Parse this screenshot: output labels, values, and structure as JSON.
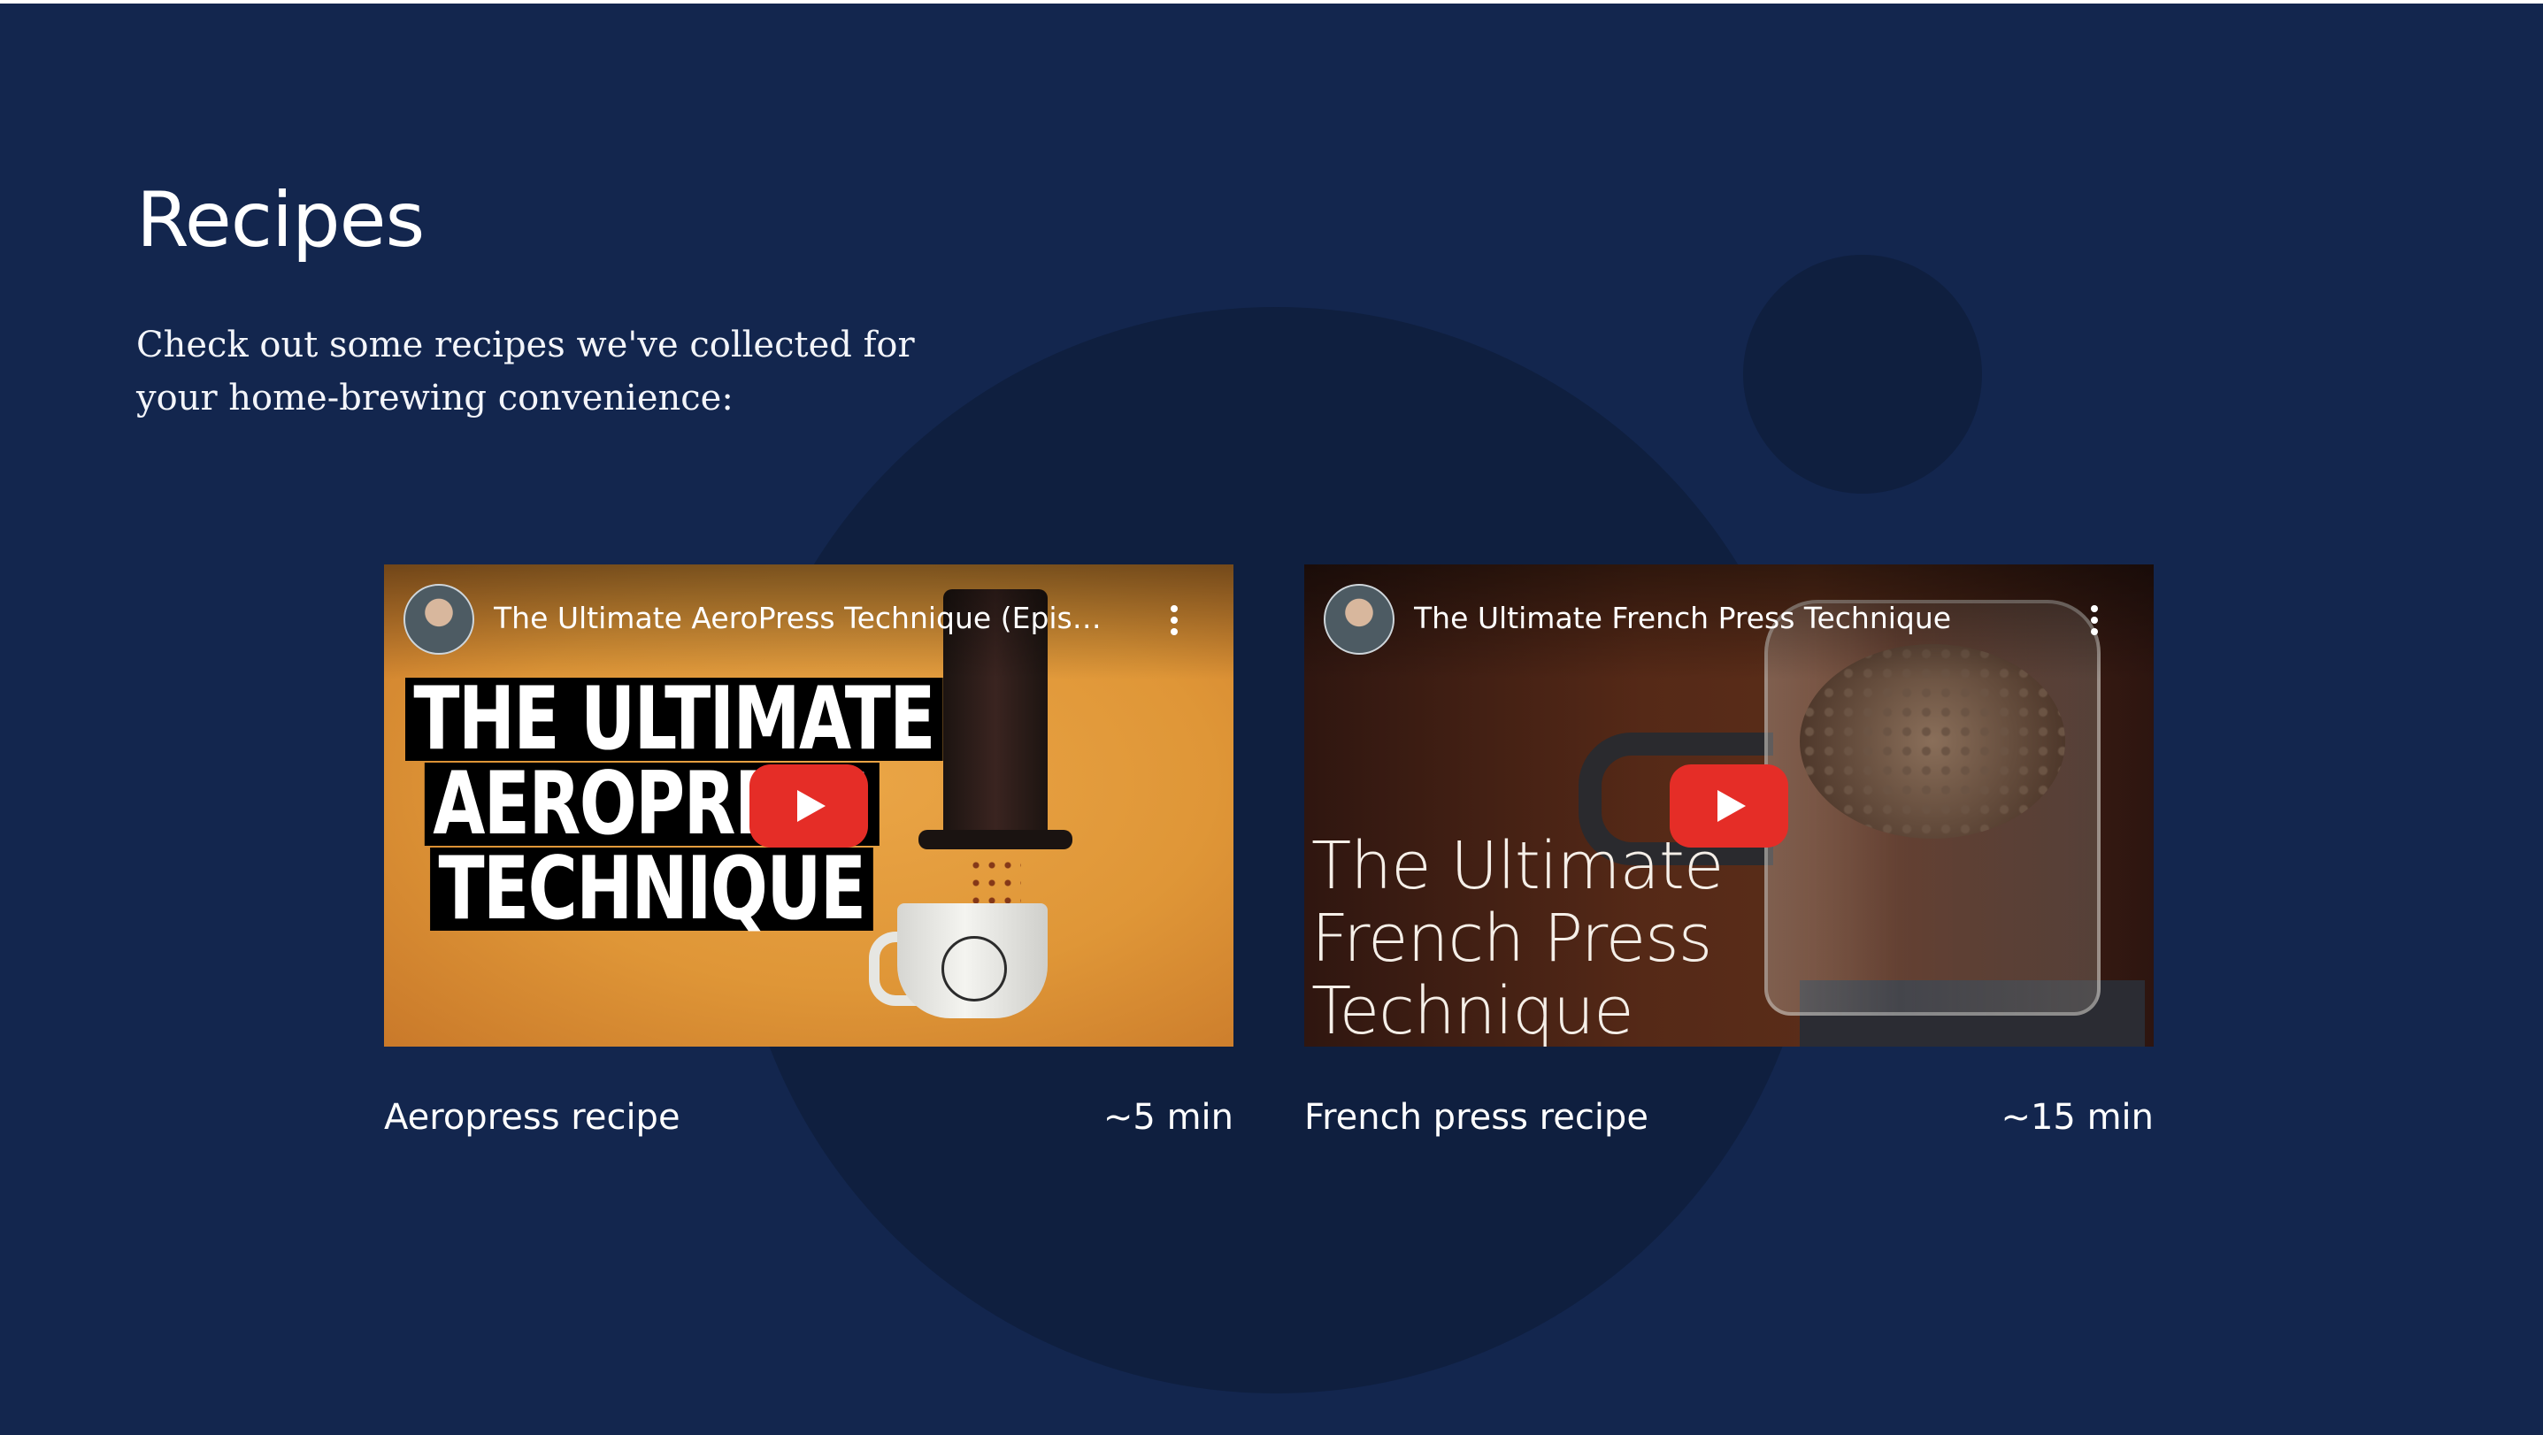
{
  "section": {
    "title": "Recipes",
    "intro": "Check out some recipes we've collected for your home-brewing convenience:"
  },
  "recipes": [
    {
      "video_title": "The Ultimate AeroPress Technique (Episod...",
      "thumbnail_text": [
        "THE ULTIMATE",
        "AEROPRESS",
        "TECHNIQUE"
      ],
      "name": "Aeropress recipe",
      "duration": "~5 min"
    },
    {
      "video_title": "The Ultimate French Press Technique",
      "thumbnail_text": [
        "The Ultimate",
        "French Press",
        "Technique"
      ],
      "name": "French press recipe",
      "duration": "~15 min"
    }
  ],
  "colors": {
    "background": "#13264e",
    "circle": "#0f1f3f",
    "play_button": "#e52d27",
    "text": "#ffffff"
  },
  "icons": [
    "play-icon",
    "more-vert-icon",
    "channel-avatar"
  ]
}
